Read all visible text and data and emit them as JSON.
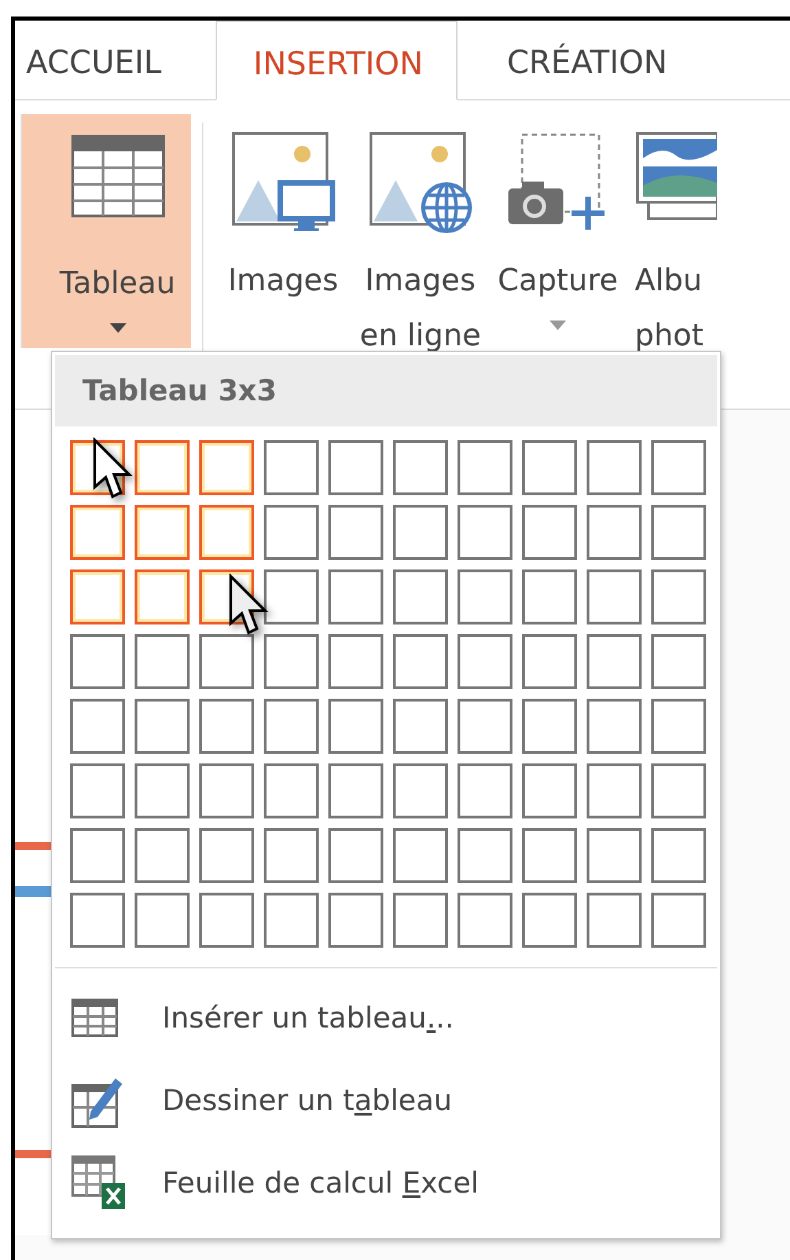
{
  "tabs": [
    {
      "label": "ACCUEIL",
      "selected": false
    },
    {
      "label": "INSERTION",
      "selected": true
    },
    {
      "label": "CRÉATION",
      "selected": false
    }
  ],
  "ribbon": {
    "buttons": [
      {
        "kind": "table",
        "lines": [
          "Tableau"
        ],
        "dropdown": true,
        "active": true
      },
      {
        "kind": "images",
        "lines": [
          "Images"
        ],
        "dropdown": false,
        "active": false
      },
      {
        "kind": "online-images",
        "lines": [
          "Images",
          "en ligne"
        ],
        "dropdown": false,
        "active": false
      },
      {
        "kind": "capture",
        "lines": [
          "Capture"
        ],
        "dropdown": true,
        "active": false
      },
      {
        "kind": "album",
        "lines": [
          "Albu",
          "phot"
        ],
        "dropdown": false,
        "active": false
      }
    ]
  },
  "table_menu": {
    "header": "Tableau 3x3",
    "grid": [
      {
        "cells": [
          {
            "selected": true
          },
          {
            "selected": true
          },
          {
            "selected": true
          },
          {
            "selected": false
          },
          {
            "selected": false
          },
          {
            "selected": false
          },
          {
            "selected": false
          },
          {
            "selected": false
          },
          {
            "selected": false
          },
          {
            "selected": false
          }
        ]
      },
      {
        "cells": [
          {
            "selected": true
          },
          {
            "selected": true
          },
          {
            "selected": true
          },
          {
            "selected": false
          },
          {
            "selected": false
          },
          {
            "selected": false
          },
          {
            "selected": false
          },
          {
            "selected": false
          },
          {
            "selected": false
          },
          {
            "selected": false
          }
        ]
      },
      {
        "cells": [
          {
            "selected": true
          },
          {
            "selected": true
          },
          {
            "selected": true
          },
          {
            "selected": false
          },
          {
            "selected": false
          },
          {
            "selected": false
          },
          {
            "selected": false
          },
          {
            "selected": false
          },
          {
            "selected": false
          },
          {
            "selected": false
          }
        ]
      },
      {
        "cells": [
          {
            "selected": false
          },
          {
            "selected": false
          },
          {
            "selected": false
          },
          {
            "selected": false
          },
          {
            "selected": false
          },
          {
            "selected": false
          },
          {
            "selected": false
          },
          {
            "selected": false
          },
          {
            "selected": false
          },
          {
            "selected": false
          }
        ]
      },
      {
        "cells": [
          {
            "selected": false
          },
          {
            "selected": false
          },
          {
            "selected": false
          },
          {
            "selected": false
          },
          {
            "selected": false
          },
          {
            "selected": false
          },
          {
            "selected": false
          },
          {
            "selected": false
          },
          {
            "selected": false
          },
          {
            "selected": false
          }
        ]
      },
      {
        "cells": [
          {
            "selected": false
          },
          {
            "selected": false
          },
          {
            "selected": false
          },
          {
            "selected": false
          },
          {
            "selected": false
          },
          {
            "selected": false
          },
          {
            "selected": false
          },
          {
            "selected": false
          },
          {
            "selected": false
          },
          {
            "selected": false
          }
        ]
      },
      {
        "cells": [
          {
            "selected": false
          },
          {
            "selected": false
          },
          {
            "selected": false
          },
          {
            "selected": false
          },
          {
            "selected": false
          },
          {
            "selected": false
          },
          {
            "selected": false
          },
          {
            "selected": false
          },
          {
            "selected": false
          },
          {
            "selected": false
          }
        ]
      },
      {
        "cells": [
          {
            "selected": false
          },
          {
            "selected": false
          },
          {
            "selected": false
          },
          {
            "selected": false
          },
          {
            "selected": false
          },
          {
            "selected": false
          },
          {
            "selected": false
          },
          {
            "selected": false
          },
          {
            "selected": false
          },
          {
            "selected": false
          }
        ]
      }
    ],
    "items": [
      {
        "kind": "insert",
        "text_before": "Insérer un tableau",
        "access_key": ".",
        "text_after": ".."
      },
      {
        "kind": "draw",
        "text_before": "Dessiner un t",
        "access_key": "a",
        "text_after": "bleau"
      },
      {
        "kind": "excel",
        "text_before": "Feuille de calcul ",
        "access_key": "E",
        "text_after": "xcel"
      }
    ]
  }
}
